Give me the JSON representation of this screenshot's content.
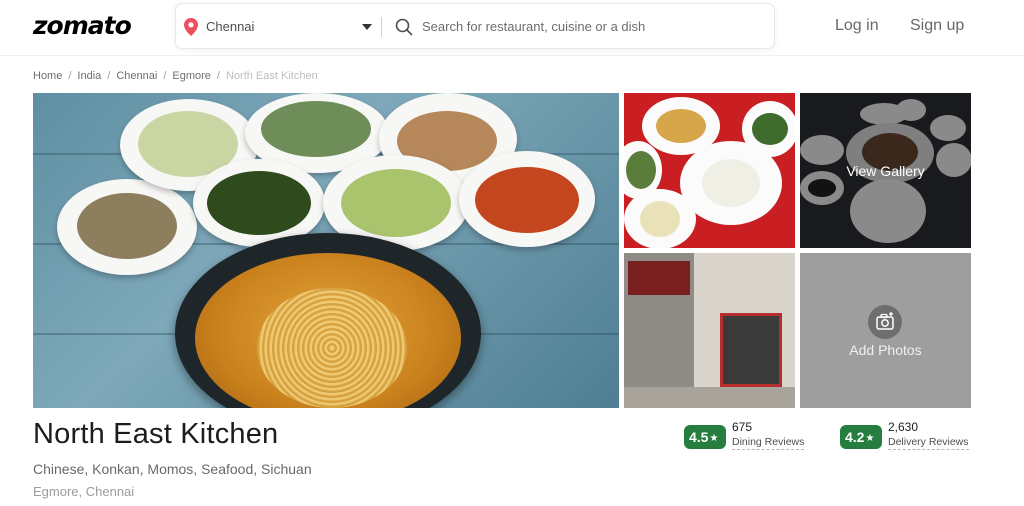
{
  "header": {
    "logo": "zomato",
    "location": "Chennai",
    "search_placeholder": "Search for restaurant, cuisine or a dish",
    "login_label": "Log in",
    "signup_label": "Sign up"
  },
  "breadcrumb": [
    "Home",
    "India",
    "Chennai",
    "Egmore",
    "North East Kitchen"
  ],
  "gallery": {
    "view_gallery_label": "View Gallery",
    "add_photos_label": "Add Photos"
  },
  "restaurant": {
    "name": "North East Kitchen",
    "cuisines": "Chinese, Konkan, Momos, Seafood, Sichuan",
    "locality": "Egmore, Chennai"
  },
  "ratings": {
    "dining": {
      "score": "4.5",
      "count": "675",
      "label": "Dining Reviews"
    },
    "delivery": {
      "score": "4.2",
      "count": "2,630",
      "label": "Delivery Reviews"
    }
  },
  "colors": {
    "brand": "#000000",
    "rating_green": "#267e3e",
    "location_pin": "#ef4f5f"
  },
  "icons": [
    "location-pin-icon",
    "caret-down-icon",
    "search-icon",
    "star-icon",
    "camera-icon"
  ]
}
